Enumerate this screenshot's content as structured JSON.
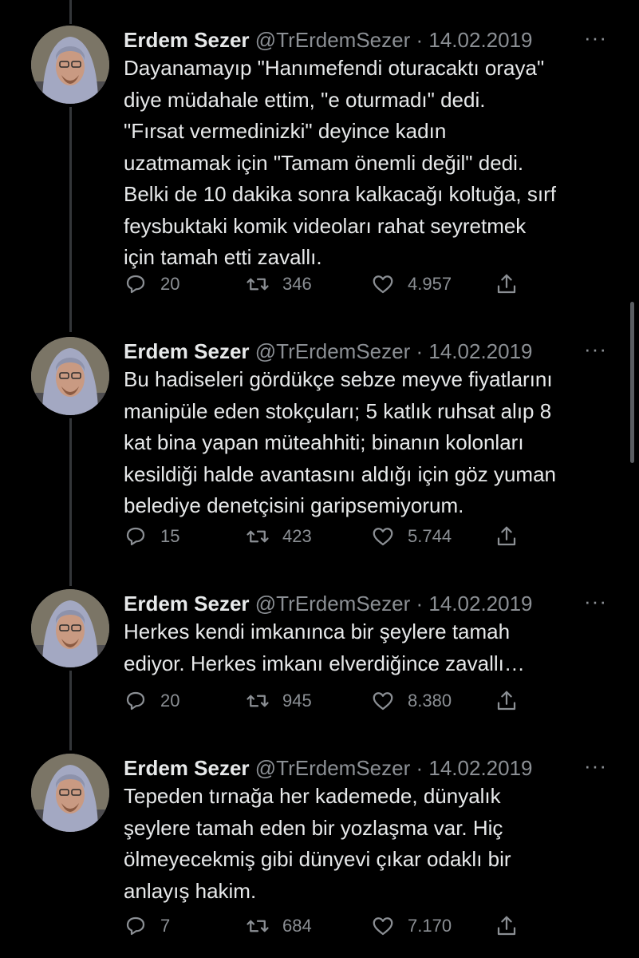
{
  "tweets": [
    {
      "name": "Erdem Sezer",
      "handle": "@TrErdemSezer",
      "separator": "·",
      "date": "14.02.2019",
      "more": "···",
      "lines": [
        "Dayanamayıp \"Hanımefendi oturacaktı oraya\"",
        "diye müdahale ettim, \"e oturmadı\" dedi.",
        "\"Fırsat vermedinizki\" deyince kadın",
        "uzatmamak için \"Tamam önemli değil\" dedi.",
        "Belki de 10 dakika sonra kalkacağı koltuğa, sırf",
        "feysbuktaki komik videoları rahat seyretmek",
        "için tamah etti zavallı."
      ],
      "replies": "20",
      "retweets": "346",
      "likes": "4.957"
    },
    {
      "name": "Erdem Sezer",
      "handle": "@TrErdemSezer",
      "separator": "·",
      "date": "14.02.2019",
      "more": "···",
      "lines": [
        "Bu hadiseleri gördükçe sebze meyve fiyatlarını",
        "manipüle eden stokçuları; 5 katlık ruhsat alıp 8",
        "kat bina yapan müteahhiti; binanın kolonları",
        "kesildiği halde avantasını aldığı için göz yuman",
        "belediye denetçisini garipsemiyorum."
      ],
      "replies": "15",
      "retweets": "423",
      "likes": "5.744"
    },
    {
      "name": "Erdem Sezer",
      "handle": "@TrErdemSezer",
      "separator": "·",
      "date": "14.02.2019",
      "more": "···",
      "lines": [
        "Herkes kendi imkanınca bir şeylere tamah",
        "ediyor. Herkes imkanı elverdiğince zavallı…"
      ],
      "replies": "20",
      "retweets": "945",
      "likes": "8.380"
    },
    {
      "name": "Erdem Sezer",
      "handle": "@TrErdemSezer",
      "separator": "·",
      "date": "14.02.2019",
      "more": "···",
      "lines": [
        "Tepeden tırnağa her kademede, dünyalık",
        "şeylere tamah eden bir yozlaşma var. Hiç",
        "ölmeyecekmiş gibi dünyevi çıkar odaklı bir",
        "anlayış hakim."
      ],
      "replies": "7",
      "retweets": "684",
      "likes": "7.170"
    }
  ],
  "icons": {
    "reply": "reply-icon",
    "retweet": "retweet-icon",
    "like": "like-icon",
    "share": "share-icon",
    "more": "more-options-icon"
  },
  "colors": {
    "background": "#000000",
    "text": "#e7e9ea",
    "secondary": "#8b8f94",
    "thread_line": "#333639"
  }
}
